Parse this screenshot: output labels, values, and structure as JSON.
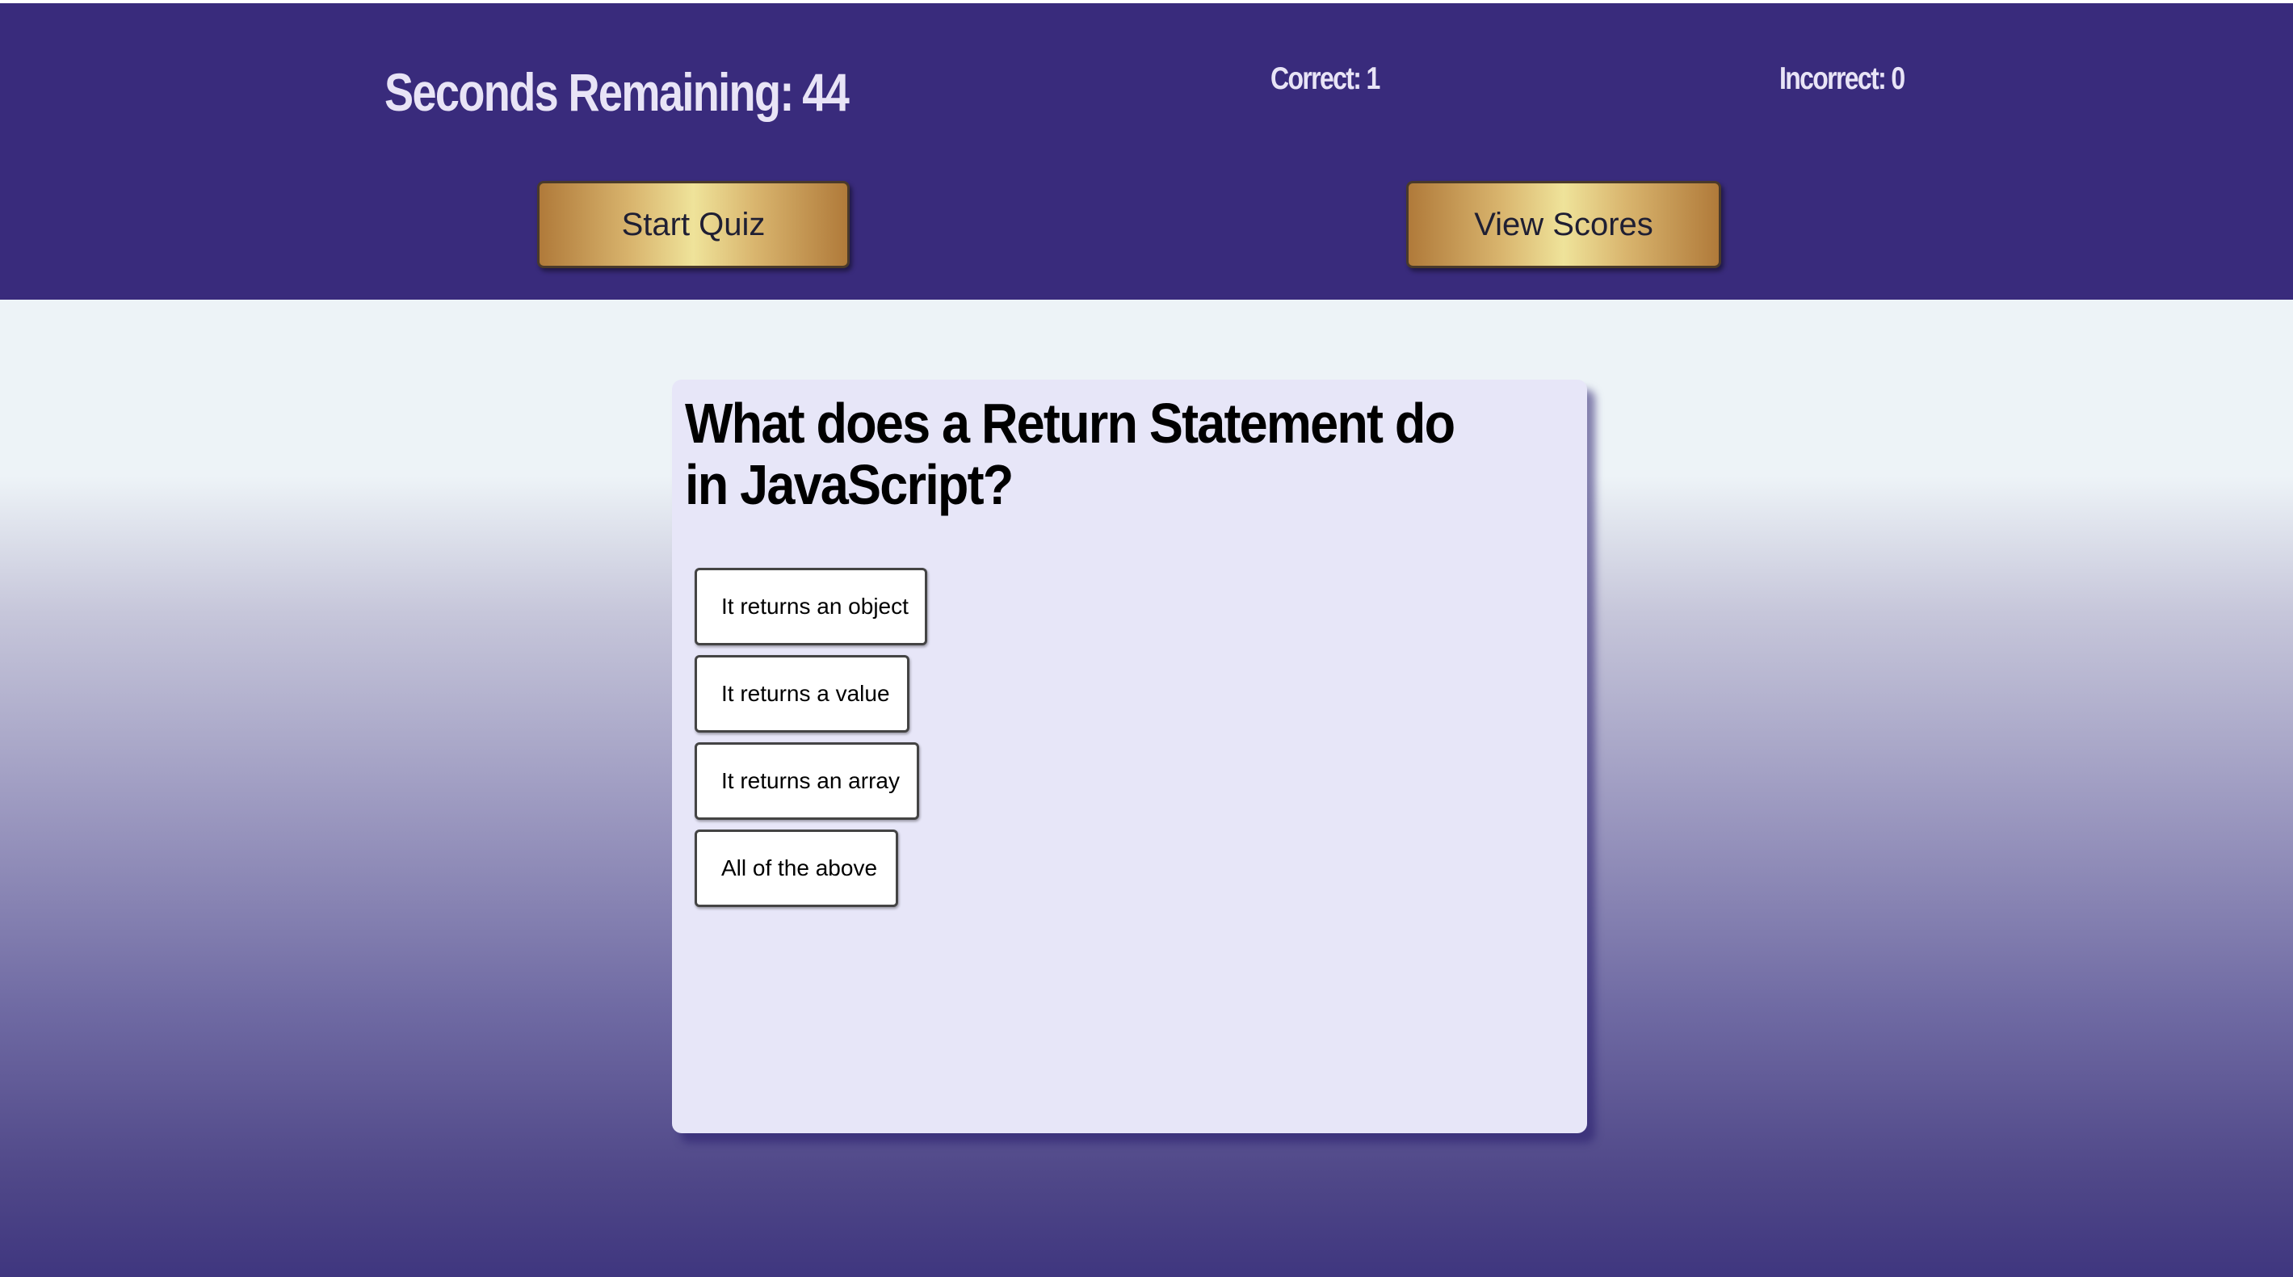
{
  "header": {
    "timer_label": "Seconds Remaining:",
    "timer_value": "44",
    "correct_label": "Correct: 1",
    "incorrect_label": "Incorrect: 0",
    "start_button": "Start Quiz",
    "scores_button": "View Scores"
  },
  "quiz": {
    "question": "What does a Return Statement do in JavaScript?",
    "answers": [
      "It returns an object",
      "It returns a value",
      "It returns an array",
      "All of the above"
    ]
  },
  "colors": {
    "header_bg": "#392b7c",
    "card_bg": "#e7e6f8",
    "header_text": "#e8e4f6",
    "button_gold": "#efe39a"
  }
}
